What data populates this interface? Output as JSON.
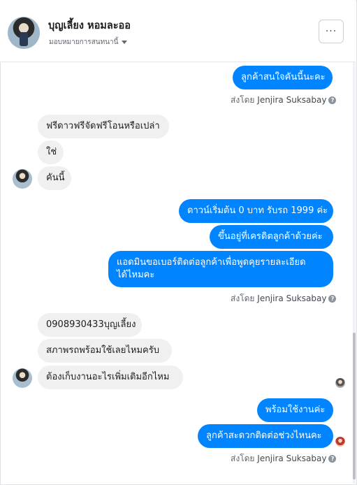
{
  "header": {
    "contact_name": "บุญเลี้ยง หอมละออ",
    "assign_label": "มอบหมายการสนทนานี้",
    "more_label": "···"
  },
  "thread": {
    "msg1": "ลูกค้าสนใจคันนี้นะคะ",
    "sent_by_prefix": "ส่งโดย",
    "sender_name": "Jenjira Suksabay",
    "help_glyph": "?",
    "msg2": "ฟรีดาวฟรีจัดฟรีโอนหรือเปล่า",
    "msg3": "ใช่",
    "msg4": "คันนี้",
    "msg5": "ดาวน์เริ่มต้น 0 บาท รับรถ 1999 ค่ะ",
    "msg6": "ขึ้นอยู่ที่เครดิตลูกค้าด้วยค่ะ",
    "msg7_line1": "แอดมินขอเบอร์ติดต่อลูกค้าเพื่อพูดคุยรายละเอียด",
    "msg7_line2": "ได้ไหมคะ",
    "msg8": "0908930433บุญเลี้ยง",
    "msg9": "สภาพรถพร้อมใช้เลยไหมครับ",
    "msg10": "ต้องเก็บงานอะไรเพิ่มเติมอีกไหม",
    "msg11": "พร้อมใช้งานค่ะ",
    "msg12": "ลูกค้าสะดวกติดต่อช่วงไหนคะ"
  },
  "colors": {
    "outgoing_bubble": "#0084ff",
    "incoming_bubble": "#f0f0f0"
  },
  "icons": {
    "more": "more-dots-icon",
    "caret": "chevron-down-icon",
    "help": "help-circle-icon"
  }
}
